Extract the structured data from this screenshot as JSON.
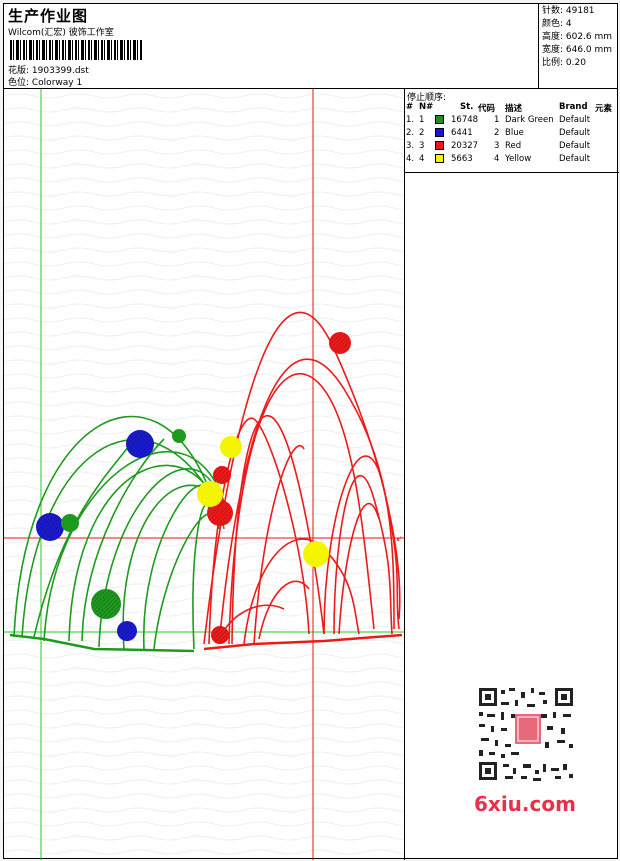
{
  "header": {
    "title": "生产作业图",
    "company": "Wilcom(汇宏) 彼饰工作室",
    "design_label": "花版: 1903399.dst",
    "colorway_label": "色位: Colorway 1"
  },
  "stats": {
    "stitches": "针数: 49181",
    "colors": "颜色: 4",
    "height": "高度: 602.6 mm",
    "width": "宽度: 646.0 mm",
    "scale": "比例: 0.20"
  },
  "stop_sequence": {
    "caption": "停止顺序:",
    "headers": [
      "#",
      "N#",
      "St.",
      "代码",
      "描述",
      "Brand",
      "元素"
    ],
    "rows": [
      {
        "idx": "1.",
        "n": "1",
        "color": "#1e8f1e",
        "stitches": "16748",
        "code": "1",
        "desc": "Dark Green",
        "brand": "Default"
      },
      {
        "idx": "2.",
        "n": "2",
        "color": "#1515d8",
        "stitches": "6441",
        "code": "2",
        "desc": "Blue",
        "brand": "Default"
      },
      {
        "idx": "3.",
        "n": "3",
        "color": "#ee1a1a",
        "stitches": "20327",
        "code": "3",
        "desc": "Red",
        "brand": "Default"
      },
      {
        "idx": "4.",
        "n": "4",
        "color": "#f5f500",
        "stitches": "5663",
        "code": "4",
        "desc": "Yellow",
        "brand": "Default"
      }
    ]
  },
  "watermark": {
    "site": "6xiu.com"
  },
  "colors": {
    "green": "#1e9a1e",
    "blue": "#1a1ad0",
    "red": "#ee1a1a",
    "yellow": "#f5f500",
    "guide_green": "#22cc22",
    "guide_red": "#ee1111"
  }
}
